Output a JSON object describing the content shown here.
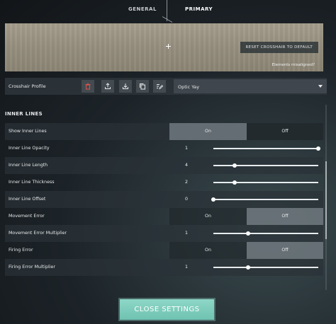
{
  "tabs": {
    "general": "GENERAL",
    "primary": "PRIMARY"
  },
  "preview": {
    "reset_label": "RESET CROSSHAIR TO DEFAULT",
    "misaligned_label": "Elements misaligned?"
  },
  "profile": {
    "label": "Crosshair Profile",
    "selected": "Optic Yay",
    "icons": [
      "trash-icon",
      "upload-icon",
      "download-icon",
      "copy-icon",
      "edit-icon"
    ]
  },
  "section": {
    "title": "INNER LINES"
  },
  "rows": {
    "show_inner_lines": {
      "label": "Show Inner Lines",
      "on": "On",
      "off": "Off",
      "selected": "On"
    },
    "opacity": {
      "label": "Inner Line Opacity",
      "value": "1",
      "fraction": 1.0
    },
    "length": {
      "label": "Inner Line Length",
      "value": "4",
      "fraction": 0.2
    },
    "thickness": {
      "label": "Inner Line Thickness",
      "value": "2",
      "fraction": 0.2
    },
    "offset": {
      "label": "Inner Line Offset",
      "value": "0",
      "fraction": 0.0
    },
    "movement_error": {
      "label": "Movement Error",
      "on": "On",
      "off": "Off",
      "selected": "Off"
    },
    "movement_multiplier": {
      "label": "Movement Error Multiplier",
      "value": "1",
      "fraction": 0.33
    },
    "firing_error": {
      "label": "Firing Error",
      "on": "On",
      "off": "Off",
      "selected": "Off"
    },
    "firing_multiplier": {
      "label": "Firing Error Multiplier",
      "value": "1",
      "fraction": 0.33
    }
  },
  "close_label": "CLOSE SETTINGS",
  "colors": {
    "accent": "#7fcdbd",
    "panel": "#2c343a"
  }
}
